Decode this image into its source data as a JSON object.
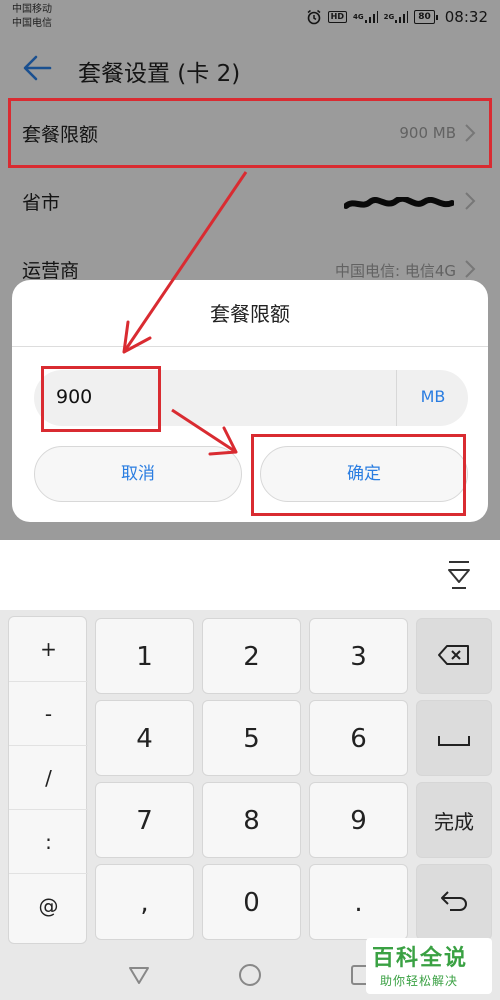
{
  "status_bar": {
    "carrier_1": "中国移动",
    "carrier_2": "中国电信",
    "hd_badge": "HD",
    "net_1": "4G",
    "net_2": "2G",
    "battery": "80",
    "time": "08:32"
  },
  "header": {
    "title": "套餐设置 (卡 2)"
  },
  "settings": {
    "rows": [
      {
        "label": "套餐限额",
        "value": "900 MB"
      },
      {
        "label": "省市",
        "value": ""
      },
      {
        "label": "运营商",
        "value": "中国电信: 电信4G"
      }
    ]
  },
  "dialog": {
    "title": "套餐限额",
    "input_value": "900",
    "unit": "MB",
    "cancel_label": "取消",
    "confirm_label": "确定"
  },
  "keyboard": {
    "symbols": [
      "+",
      "-",
      "/",
      ":",
      "@"
    ],
    "digits": [
      [
        "1",
        "2",
        "3"
      ],
      [
        "4",
        "5",
        "6"
      ],
      [
        "7",
        "8",
        "9"
      ],
      [
        ",",
        "0",
        "."
      ]
    ],
    "done_label": "完成"
  },
  "watermark": {
    "title": "百科全说",
    "subtitle": "助你轻松解决"
  },
  "colors": {
    "accent": "#2a7de1",
    "annotation": "#d92b31",
    "watermark": "#3aa143"
  }
}
